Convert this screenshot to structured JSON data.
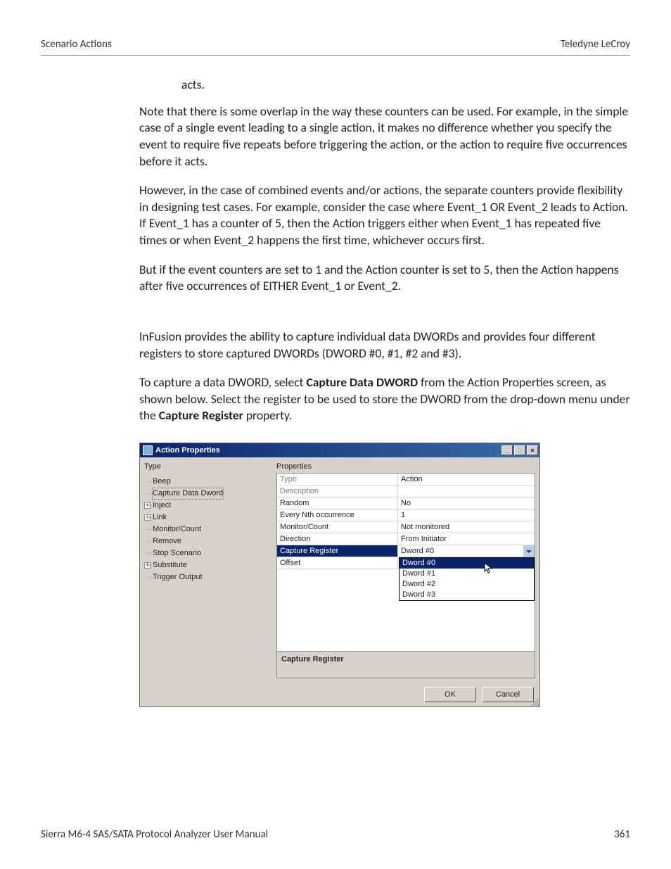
{
  "header": {
    "left": "Scenario Actions",
    "right": "Teledyne LeCroy"
  },
  "body": {
    "fragment": "acts.",
    "p1": "Note that there is some overlap in the way these counters can be used. For example, in the simple case of a single event leading to a single action, it makes no difference whether you specify the event to require five repeats before triggering the action, or the action to require five occurrences before it acts.",
    "p2": "However, in the case of combined events and/or actions, the separate counters provide flexibility in designing test cases. For example, consider the case where Event_1 OR Event_2 leads to Action. If Event_1 has a counter of 5, then the Action triggers either when Event_1 has repeated five times or when Event_2 happens the first time, whichever occurs first.",
    "p3": "But if the event counters are set to 1 and the Action counter is set to 5, then the Action happens after five occurrences of EITHER Event_1 or Event_2.",
    "p4": "InFusion provides the ability to capture individual data DWORDs and provides four different registers to store captured DWORDs (DWORD #0, #1, #2 and #3).",
    "p5a": "To capture a data DWORD, select ",
    "p5b": "Capture Data DWORD",
    "p5c": " from the Action Properties screen, as shown below. Select the register to be used to store the DWORD from the drop-down menu under the ",
    "p5d": "Capture Register",
    "p5e": " property."
  },
  "dialog": {
    "title": "Action Properties",
    "type_label": "Type",
    "properties_label": "Properties",
    "tree": {
      "beep": "Beep",
      "capture": "Capture Data Dword",
      "inject": "Inject",
      "link": "Link",
      "monitor": "Monitor/Count",
      "remove": "Remove",
      "stop": "Stop Scenario",
      "substitute": "Substitute",
      "trigger": "Trigger Output"
    },
    "props": {
      "type_k": "Type",
      "type_v": "Action",
      "desc_k": "Description",
      "desc_v": "",
      "random_k": "Random",
      "random_v": "No",
      "nth_k": "Every Nth occurrence",
      "nth_v": "1",
      "mon_k": "Monitor/Count",
      "mon_v": "Not monitored",
      "dir_k": "Direction",
      "dir_v": "From Initiator",
      "cap_k": "Capture Register",
      "cap_v": "Dword #0",
      "off_k": "Offset",
      "off_v": ""
    },
    "dropdown": {
      "opt0": "Dword #0",
      "opt1": "Dword #1",
      "opt2": "Dword #2",
      "opt3": "Dword #3"
    },
    "desc_title": "Capture Register",
    "ok": "OK",
    "cancel": "Cancel"
  },
  "footer": {
    "left": "Sierra M6-4 SAS/SATA Protocol Analyzer User Manual",
    "right": "361"
  }
}
